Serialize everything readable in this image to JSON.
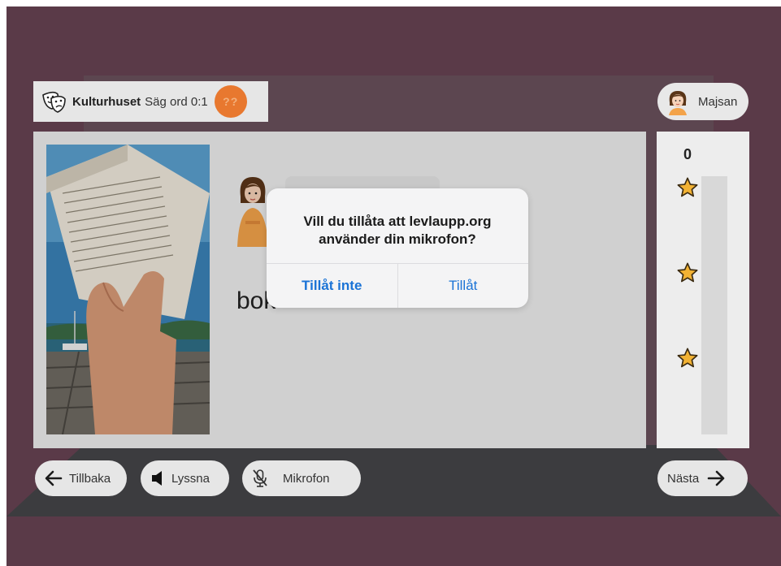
{
  "header": {
    "place": "Kulturhuset",
    "mode": "Säg ord 0:1",
    "hint_badge": "??"
  },
  "user": {
    "name": "Majsan"
  },
  "exercise": {
    "word": "bok"
  },
  "score": {
    "value": "0",
    "stars": 3,
    "progress_fraction": 0
  },
  "buttons": {
    "back": "Tillbaka",
    "listen": "Lyssna",
    "microphone": "Mikrofon",
    "next": "Nästa"
  },
  "dialog": {
    "message": "Vill du tillåta att levlaupp.org använder din mikrofon?",
    "deny": "Tillåt inte",
    "allow": "Tillåt"
  },
  "colors": {
    "background": "#5a3a48",
    "accent_orange": "#e8782f",
    "star": "#f2b233",
    "dialog_action": "#1a73d6"
  },
  "icons": {
    "theater": "theater-masks-icon",
    "back": "arrow-left-icon",
    "listen": "speaker-icon",
    "microphone": "microphone-muted-icon",
    "next": "arrow-right-icon",
    "star": "star-icon"
  }
}
